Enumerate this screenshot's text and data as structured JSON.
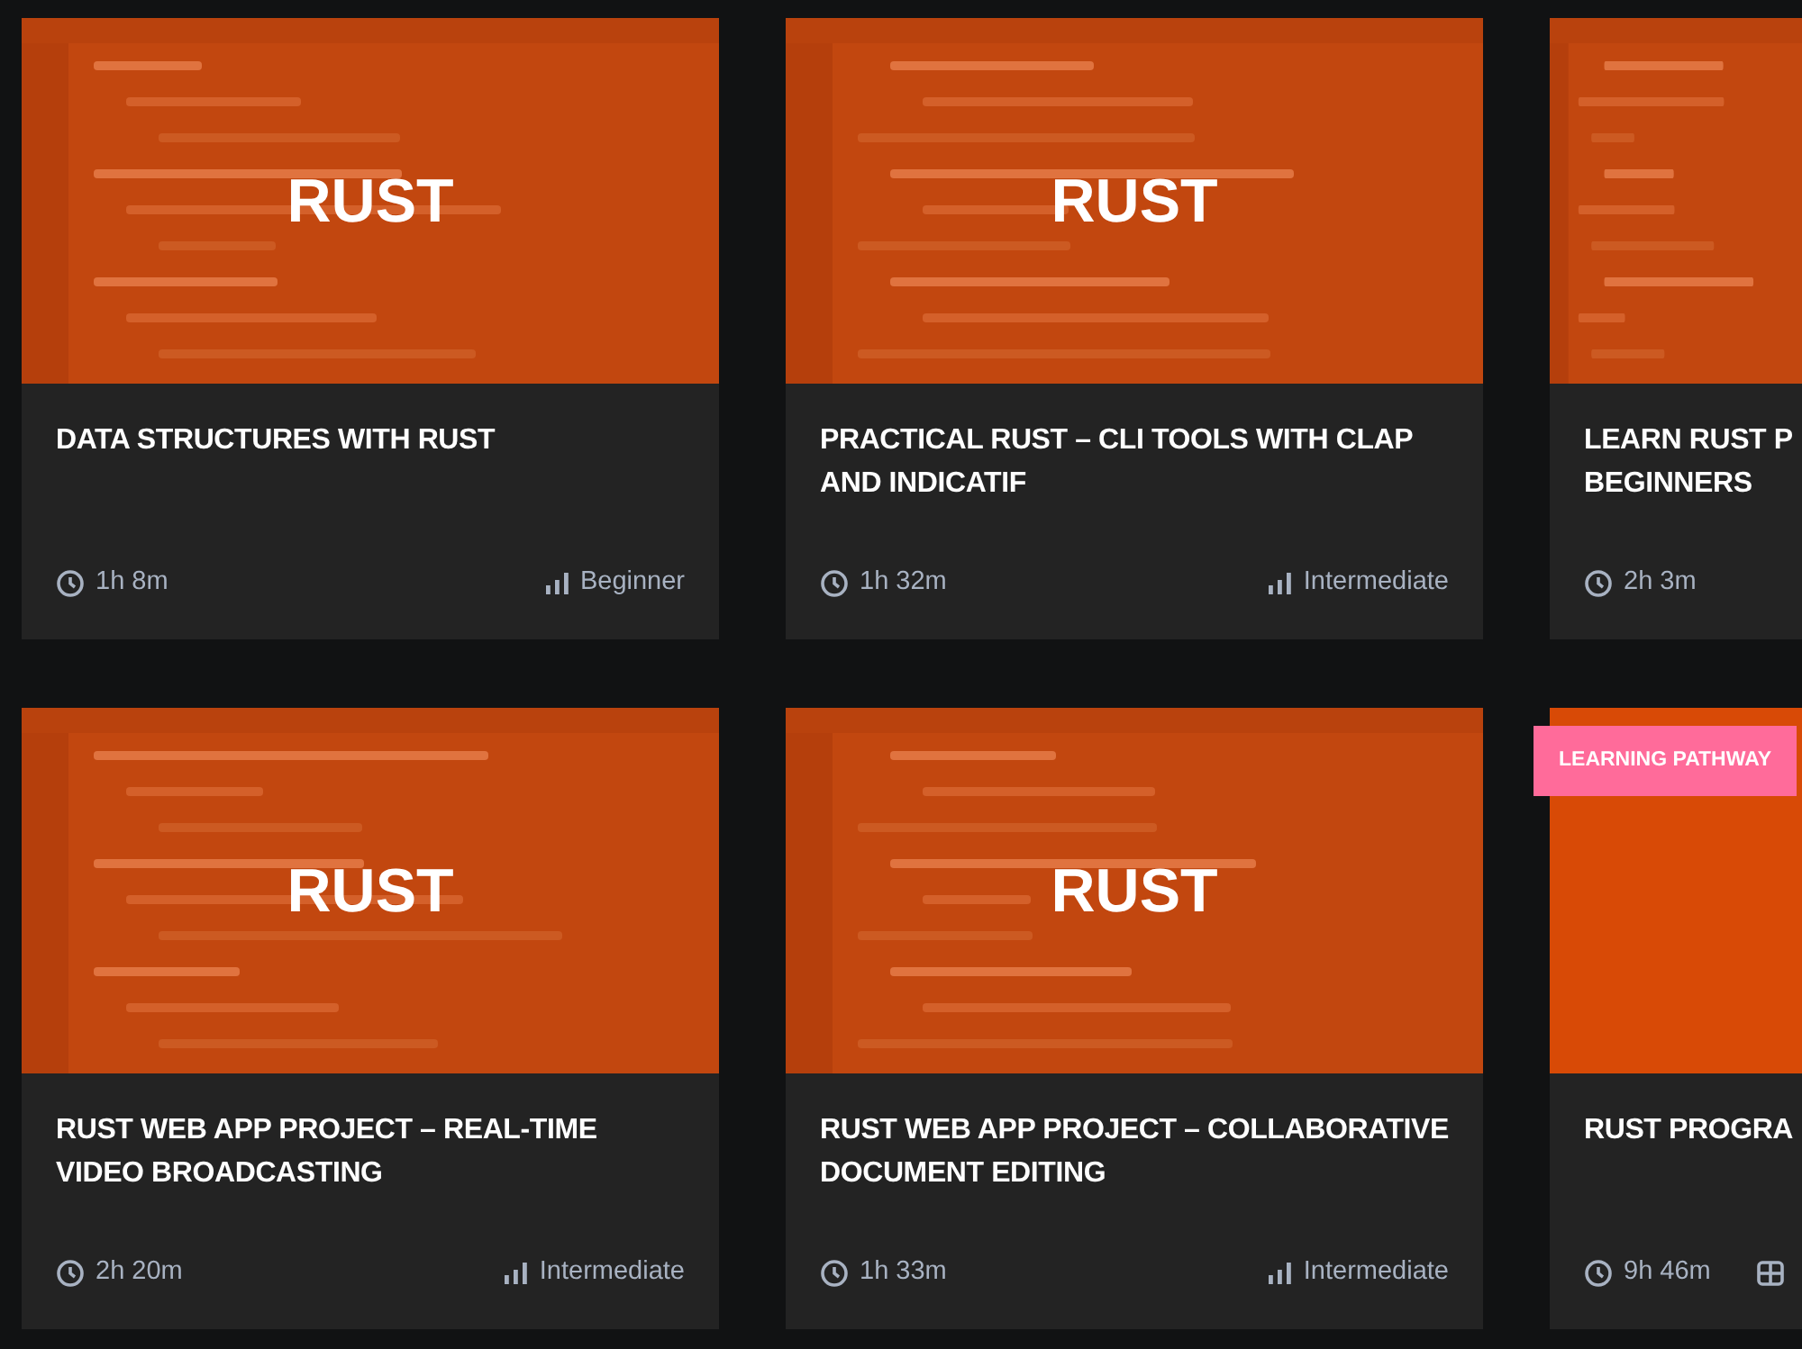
{
  "courses": [
    {
      "title": "DATA STRUCTURES WITH RUST",
      "thumbnail": {
        "kind": "screenshot",
        "label": "RUST"
      },
      "duration": "1h 8m",
      "meta": {
        "kind": "difficulty",
        "text": "Beginner"
      }
    },
    {
      "title": "PRACTICAL RUST – CLI TOOLS WITH CLAP AND INDICATIF",
      "thumbnail": {
        "kind": "screenshot",
        "label": "RUST"
      },
      "duration": "1h 32m",
      "meta": {
        "kind": "difficulty",
        "text": "Intermediate"
      }
    },
    {
      "title": "LEARN RUST P",
      "title_line_2": "BEGINNERS",
      "thumbnail": {
        "kind": "screenshot"
      },
      "duration": "2h 3m"
    },
    {
      "title": "RUST WEB APP PROJECT – REAL-TIME VIDEO BROADCASTING",
      "thumbnail": {
        "kind": "screenshot",
        "label": "RUST"
      },
      "duration": "2h 20m",
      "meta": {
        "kind": "difficulty",
        "text": "Intermediate"
      }
    },
    {
      "title": "RUST WEB APP PROJECT – COLLABORATIVE DOCUMENT EDITING",
      "thumbnail": {
        "kind": "screenshot",
        "label": "RUST"
      },
      "duration": "1h 33m",
      "meta": {
        "kind": "difficulty",
        "text": "Intermediate"
      }
    },
    {
      "title": "RUST PROGRA",
      "badge": "LEARNING PATHWAY",
      "thumbnail": {
        "kind": "plain"
      },
      "duration": "9h 46m",
      "meta": {
        "kind": "modules"
      }
    }
  ]
}
